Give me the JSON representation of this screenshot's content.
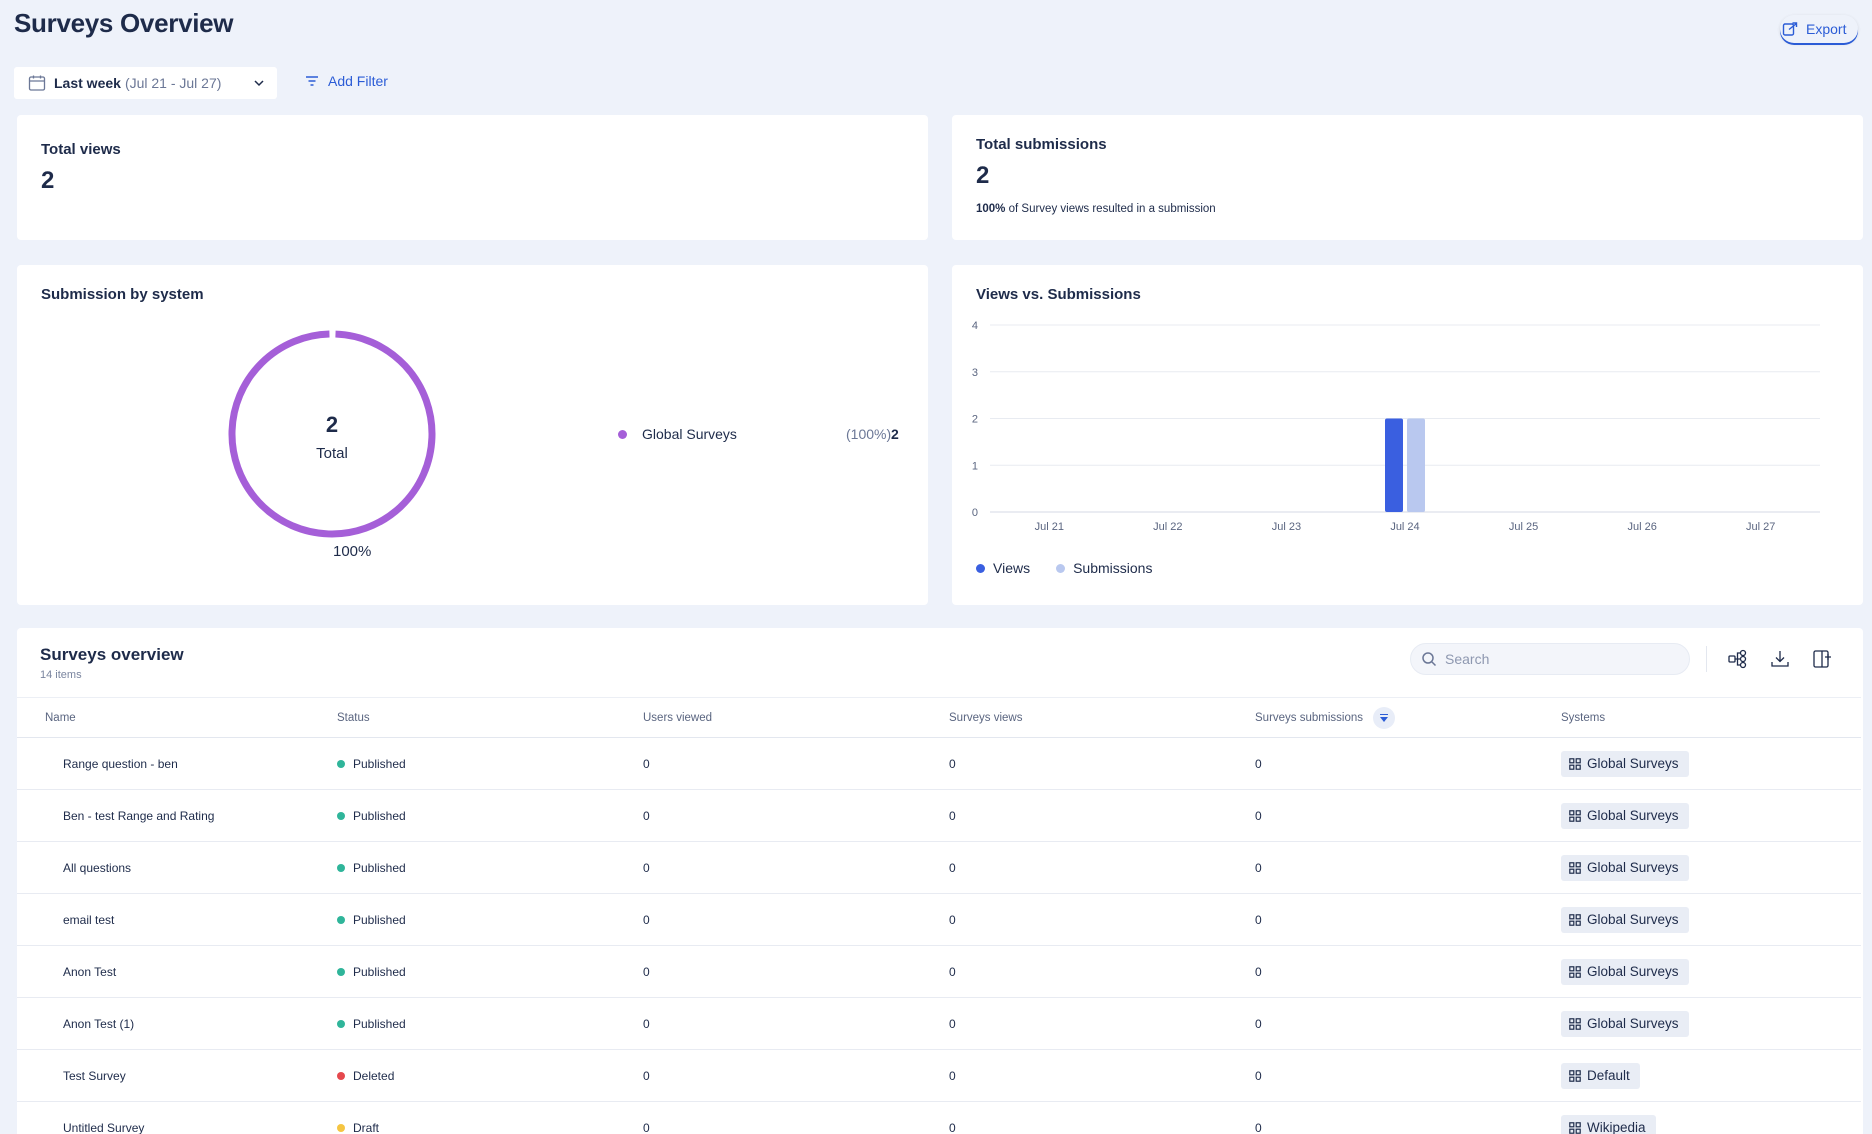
{
  "header": {
    "title": "Surveys Overview",
    "export_label": "Export"
  },
  "filters": {
    "date_label": "Last week",
    "date_range": "(Jul 21 - Jul 27)",
    "add_filter_label": "Add Filter"
  },
  "total_views": {
    "title": "Total views",
    "value": "2"
  },
  "total_submissions": {
    "title": "Total submissions",
    "value": "2",
    "note_bold": "100%",
    "note_text": " of Survey views resulted in a submission"
  },
  "submission_by_system": {
    "title": "Submission by system",
    "center_value": "2",
    "center_label": "Total",
    "slice_percent": "100%",
    "legend": [
      {
        "name": "Global Surveys",
        "percent": "(100%)",
        "value": "2",
        "color": "#a55fd8"
      }
    ]
  },
  "views_vs_submissions": {
    "title": "Views vs. Submissions",
    "legend": [
      {
        "name": "Views",
        "color": "#3a5fe0"
      },
      {
        "name": "Submissions",
        "color": "#b9c8ef"
      }
    ]
  },
  "chart_data": {
    "type": "bar",
    "title": "Views vs. Submissions",
    "categories": [
      "Jul 21",
      "Jul 22",
      "Jul 23",
      "Jul 24",
      "Jul 25",
      "Jul 26",
      "Jul 27"
    ],
    "series": [
      {
        "name": "Views",
        "values": [
          0,
          0,
          0,
          2,
          0,
          0,
          0
        ],
        "color": "#3a5fe0"
      },
      {
        "name": "Submissions",
        "values": [
          0,
          0,
          0,
          2,
          0,
          0,
          0
        ],
        "color": "#b9c8ef"
      }
    ],
    "ylim": [
      0,
      4
    ],
    "yticks": [
      "0",
      "1",
      "2",
      "3",
      "4"
    ],
    "grid": true,
    "legend_position": "bottom-left"
  },
  "overview": {
    "title": "Surveys overview",
    "count": "14 items",
    "search_placeholder": "Search",
    "columns": [
      "Name",
      "Status",
      "Users viewed",
      "Surveys views",
      "Surveys submissions",
      "Systems"
    ],
    "rows": [
      {
        "name": "Range question - ben",
        "status": "Published",
        "status_color": "#2fb59a",
        "users_viewed": "0",
        "views": "0",
        "submissions": "0",
        "system": "Global Surveys"
      },
      {
        "name": "Ben - test Range and Rating",
        "status": "Published",
        "status_color": "#2fb59a",
        "users_viewed": "0",
        "views": "0",
        "submissions": "0",
        "system": "Global Surveys"
      },
      {
        "name": "All questions",
        "status": "Published",
        "status_color": "#2fb59a",
        "users_viewed": "0",
        "views": "0",
        "submissions": "0",
        "system": "Global Surveys"
      },
      {
        "name": "email test",
        "status": "Published",
        "status_color": "#2fb59a",
        "users_viewed": "0",
        "views": "0",
        "submissions": "0",
        "system": "Global Surveys"
      },
      {
        "name": "Anon Test",
        "status": "Published",
        "status_color": "#2fb59a",
        "users_viewed": "0",
        "views": "0",
        "submissions": "0",
        "system": "Global Surveys"
      },
      {
        "name": "Anon Test (1)",
        "status": "Published",
        "status_color": "#2fb59a",
        "users_viewed": "0",
        "views": "0",
        "submissions": "0",
        "system": "Global Surveys"
      },
      {
        "name": "Test Survey",
        "status": "Deleted",
        "status_color": "#e5484d",
        "users_viewed": "0",
        "views": "0",
        "submissions": "0",
        "system": "Default"
      },
      {
        "name": "Untitled Survey",
        "status": "Draft",
        "status_color": "#f5c542",
        "users_viewed": "0",
        "views": "0",
        "submissions": "0",
        "system": "Wikipedia"
      }
    ]
  }
}
